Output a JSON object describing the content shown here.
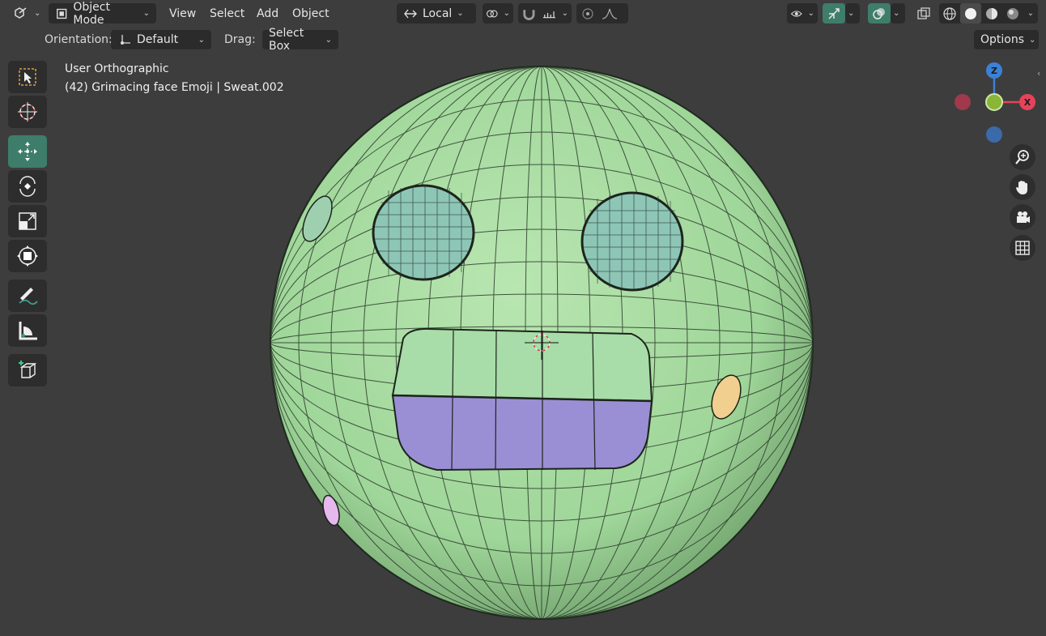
{
  "header": {
    "mode": "Object Mode",
    "menus": [
      "View",
      "Select",
      "Add",
      "Object"
    ],
    "transform_orientation": "Local",
    "options_label": "Options"
  },
  "subheader": {
    "orientation_label": "Orientation:",
    "orientation_value": "Default",
    "drag_label": "Drag:",
    "drag_value": "Select Box"
  },
  "viewport": {
    "view_name": "User Orthographic",
    "object_info": "(42) Grimacing face Emoji | Sweat.002"
  },
  "gizmo": {
    "axes": [
      "Z",
      "X"
    ],
    "colors": {
      "x": "#e6435a",
      "y": "#8ab638",
      "z": "#3a82d6"
    }
  },
  "icons": {
    "toolbar": [
      "select-box-icon",
      "cursor-icon",
      "move-icon",
      "rotate-icon",
      "scale-icon",
      "transform-icon",
      "annotate-icon",
      "measure-icon",
      "add-cube-icon"
    ],
    "nav": [
      "zoom-icon",
      "pan-hand-icon",
      "camera-icon",
      "grid-icon"
    ]
  },
  "colors": {
    "background": "#3d3d3d",
    "mesh": "#a6dca0",
    "teeth_lower": "#9a8fd4",
    "accent": "#3e7d6a"
  }
}
